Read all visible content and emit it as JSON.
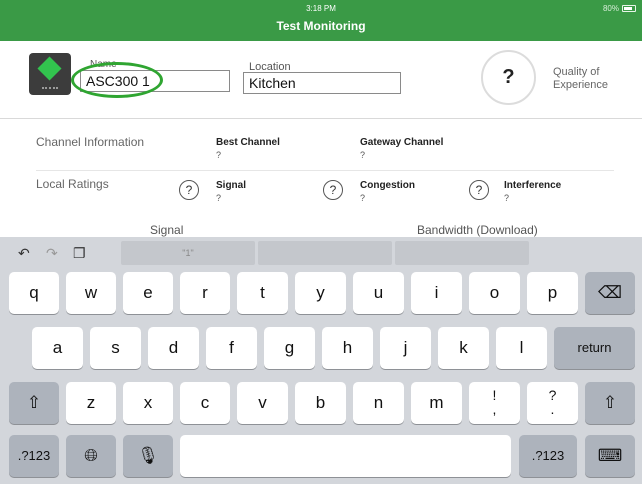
{
  "status_bar": {
    "time": "3:18 PM",
    "battery": "80%"
  },
  "header": {
    "title": "Test Monitoring"
  },
  "device": {
    "name_label": "Name",
    "name_value": "ASC300 1",
    "location_label": "Location",
    "location_value": "Kitchen",
    "qoe_value": "?",
    "qoe_label": "Quality of Experience"
  },
  "channel_info": {
    "label": "Channel Information",
    "best_channel": {
      "label": "Best Channel",
      "value": "?"
    },
    "gateway_channel": {
      "label": "Gateway Channel",
      "value": "?"
    }
  },
  "local_ratings": {
    "label": "Local Ratings",
    "help": "?",
    "signal": {
      "label": "Signal",
      "value": "?"
    },
    "congestion": {
      "label": "Congestion",
      "value": "?"
    },
    "interference": {
      "label": "Interference",
      "value": "?"
    }
  },
  "sections": {
    "signal": "Signal",
    "bandwidth": "Bandwidth (Download)"
  },
  "keyboard": {
    "suggestion_1": "\"1\"",
    "row1": [
      "q",
      "w",
      "e",
      "r",
      "t",
      "y",
      "u",
      "i",
      "o",
      "p"
    ],
    "row2": [
      "a",
      "s",
      "d",
      "f",
      "g",
      "h",
      "j",
      "k",
      "l"
    ],
    "row3": [
      "z",
      "x",
      "c",
      "v",
      "b",
      "n",
      "m"
    ],
    "return": "return",
    "numbers": ".?123",
    "punct_1_top": "!",
    "punct_1_bottom": ",",
    "punct_2_top": "?",
    "punct_2_bottom": "."
  }
}
